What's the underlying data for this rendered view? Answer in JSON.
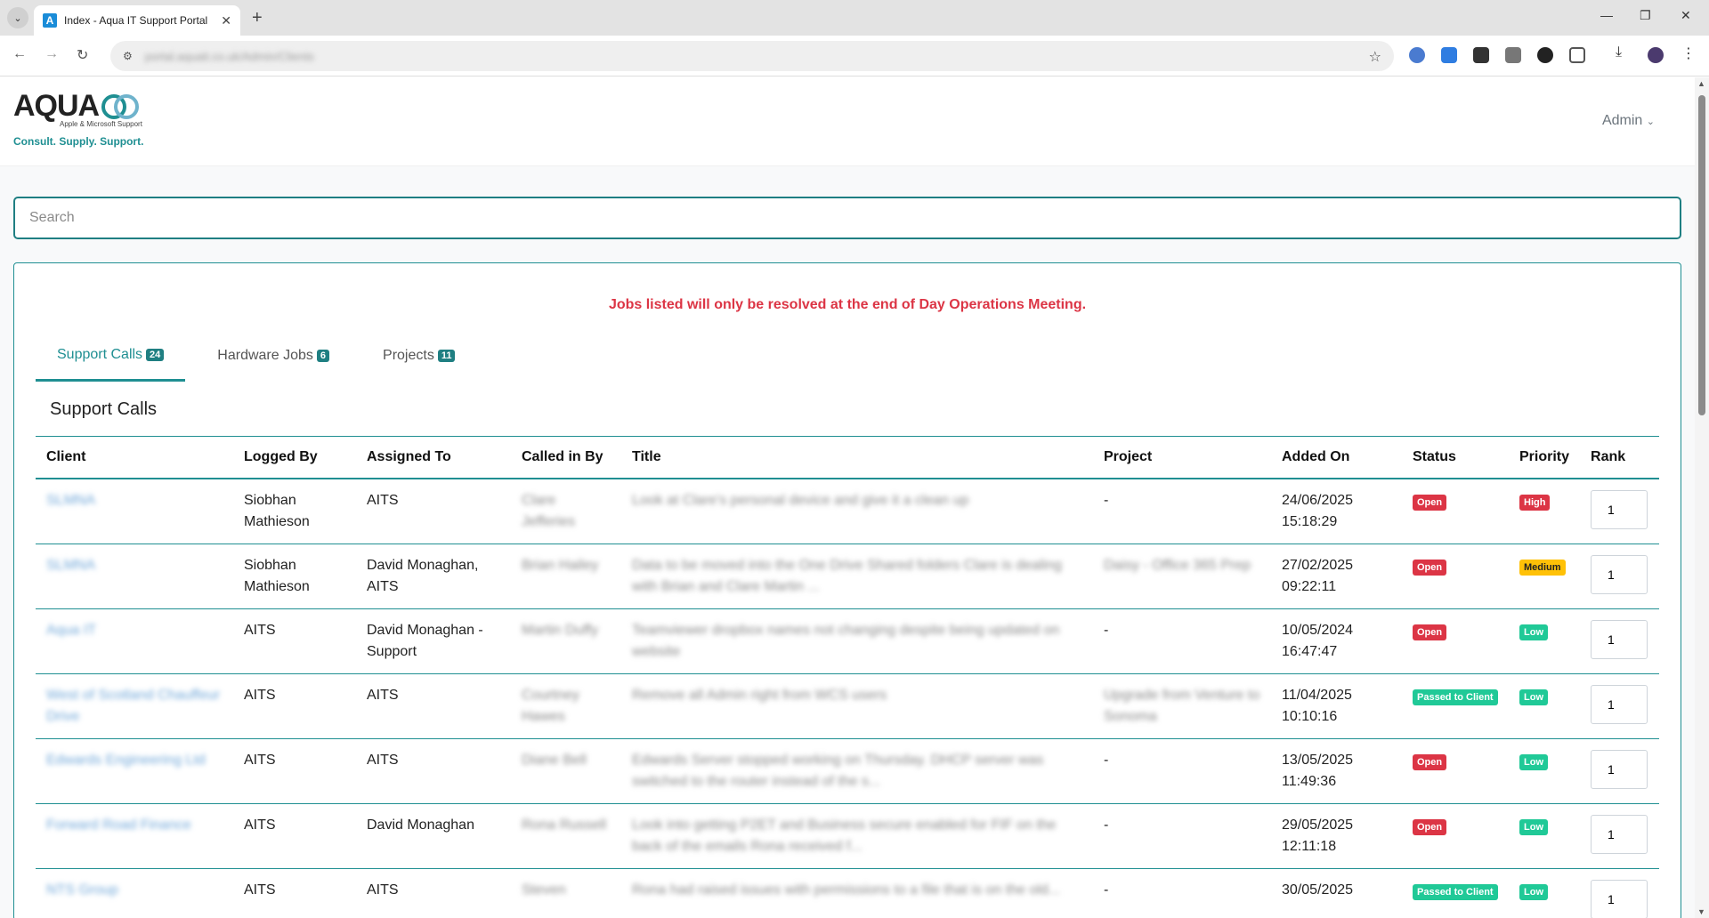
{
  "browser": {
    "tab_title": "Index - Aqua IT Support Portal",
    "favicon_letter": "A",
    "url": "portal.aquait.co.uk/Admin/Clients"
  },
  "header": {
    "logo_word": "AQUA",
    "logo_sub": "Apple & Microsoft Support",
    "logo_tagline": "Consult. Supply. Support.",
    "admin_menu": "Admin"
  },
  "search": {
    "placeholder": "Search"
  },
  "notice": "Jobs listed will only be resolved at the end of Day Operations Meeting.",
  "tabs": [
    {
      "label": "Support Calls",
      "count": "24"
    },
    {
      "label": "Hardware Jobs",
      "count": "6"
    },
    {
      "label": "Projects",
      "count": "11"
    }
  ],
  "section_title": "Support Calls",
  "table": {
    "headers": [
      "Client",
      "Logged By",
      "Assigned To",
      "Called in By",
      "Title",
      "Project",
      "Added On",
      "Status",
      "Priority",
      "Rank"
    ],
    "rows": [
      {
        "client": "SLMNA",
        "logged_by": "Siobhan Mathieson",
        "assigned_to": "AITS",
        "called_in_by": "Clare Jefferies",
        "title": "Look at Clare's personal device and give it a clean up",
        "project": "-",
        "added_on": "24/06/2025 15:18:29",
        "status": "Open",
        "priority": "High",
        "rank": "1"
      },
      {
        "client": "SLMNA",
        "logged_by": "Siobhan Mathieson",
        "assigned_to": "David Monaghan, AITS",
        "called_in_by": "Brian Hailey",
        "title": "Data to be moved into the One Drive Shared folders Clare is dealing with Brian and Clare Martin ...",
        "project": "Daisy - Office 365 Prep",
        "added_on": "27/02/2025 09:22:11",
        "status": "Open",
        "priority": "Medium",
        "rank": "1"
      },
      {
        "client": "Aqua IT",
        "logged_by": "AITS",
        "assigned_to": "David Monaghan - Support",
        "called_in_by": "Martin Duffy",
        "title": "Teamviewer dropbox names not changing despite being updated on website",
        "project": "-",
        "added_on": "10/05/2024 16:47:47",
        "status": "Open",
        "priority": "Low",
        "rank": "1"
      },
      {
        "client": "West of Scotland Chauffeur Drive",
        "logged_by": "AITS",
        "assigned_to": "AITS",
        "called_in_by": "Courtney Hawes",
        "title": "Remove all Admin right from WCS users",
        "project": "Upgrade from Venture to Sonoma",
        "added_on": "11/04/2025 10:10:16",
        "status": "Passed to Client",
        "priority": "Low",
        "rank": "1"
      },
      {
        "client": "Edwards Engineering Ltd",
        "logged_by": "AITS",
        "assigned_to": "AITS",
        "called_in_by": "Diane Bell",
        "title": "Edwards Server stopped working on Thursday. DHCP server was switched to the router instead of the s...",
        "project": "-",
        "added_on": "13/05/2025 11:49:36",
        "status": "Open",
        "priority": "Low",
        "rank": "1"
      },
      {
        "client": "Forward Road Finance",
        "logged_by": "AITS",
        "assigned_to": "David Monaghan",
        "called_in_by": "Rona Russell",
        "title": "Look into getting P2ET and Business secure enabled for FIF on the back of the emails Rona received f...",
        "project": "-",
        "added_on": "29/05/2025 12:11:18",
        "status": "Open",
        "priority": "Low",
        "rank": "1"
      },
      {
        "client": "NTS Group",
        "logged_by": "AITS",
        "assigned_to": "AITS",
        "called_in_by": "Steven",
        "title": "Rona had raised issues with permissions to a file that is on the old...",
        "project": "-",
        "added_on": "30/05/2025",
        "status": "Passed to Client",
        "priority": "Low",
        "rank": "1"
      }
    ]
  },
  "colors": {
    "accent": "#1f8f92",
    "danger": "#dc3545",
    "success": "#20c997",
    "warning": "#ffc107"
  }
}
